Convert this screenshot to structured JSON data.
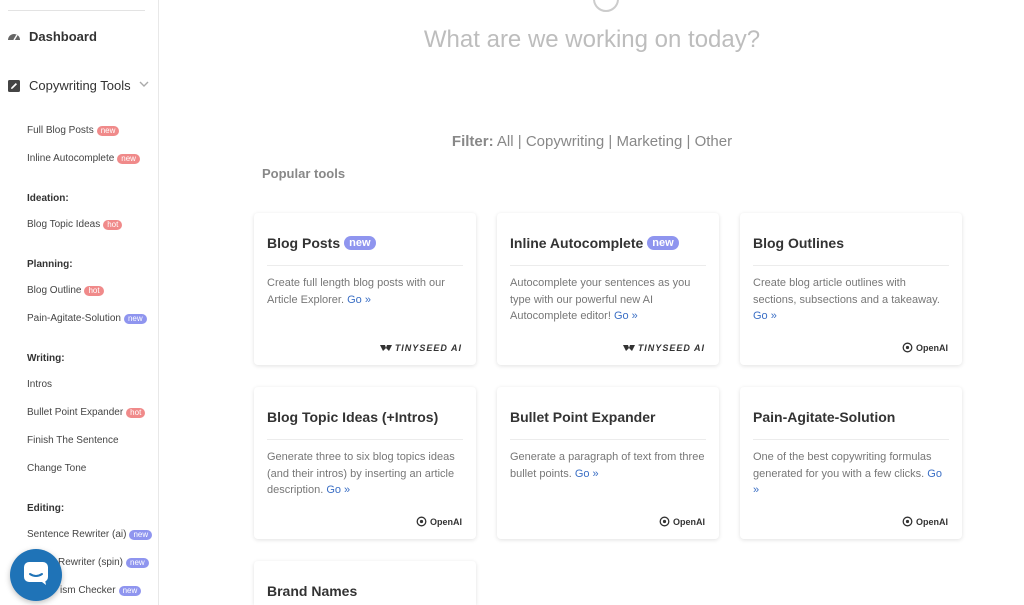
{
  "sidebar": {
    "dashboard": "Dashboard",
    "copywriting_tools": "Copywriting Tools",
    "items": {
      "full_blog_posts": "Full Blog Posts",
      "inline_autocomplete": "Inline Autocomplete",
      "ideation": "Ideation:",
      "blog_topic_ideas": "Blog Topic Ideas",
      "planning": "Planning:",
      "blog_outline": "Blog Outline",
      "pas": "Pain-Agitate-Solution",
      "writing": "Writing:",
      "intros": "Intros",
      "bullet_point_expander": "Bullet Point Expander",
      "finish_the_sentence": "Finish The Sentence",
      "change_tone": "Change Tone",
      "editing": "Editing:",
      "sentence_rewriter_ai": "Sentence Rewriter (ai)",
      "rewriter_spin": "Rewriter (spin)",
      "plagiarism_checker": "ism Checker"
    },
    "badges": {
      "new": "new",
      "hot": "hot"
    }
  },
  "main": {
    "title": "What are we working on today?",
    "filter": {
      "label": "Filter:",
      "all": "All",
      "copywriting": "Copywriting",
      "marketing": "Marketing",
      "other": "Other",
      "sep": "|"
    },
    "popular": "Popular tools"
  },
  "cards": {
    "c1": {
      "title": "Blog Posts",
      "badge": "new",
      "desc": "Create full length blog posts with our Article Explorer.",
      "go": "Go »",
      "provider": "TINYSEED AI"
    },
    "c2": {
      "title": "Inline Autocomplete",
      "badge": "new",
      "desc": "Autocomplete your sentences as you type with our powerful new AI Autocomplete editor!",
      "go": "Go »",
      "provider": "TINYSEED AI"
    },
    "c3": {
      "title": "Blog Outlines",
      "desc": "Create blog article outlines with sections, subsections and a takeaway.",
      "go": "Go »",
      "provider": "OpenAI"
    },
    "c4": {
      "title": "Blog Topic Ideas (+Intros)",
      "desc": "Generate three to six blog topics ideas (and their intros) by inserting an article description.",
      "go": "Go »",
      "provider": "OpenAI"
    },
    "c5": {
      "title": "Bullet Point Expander",
      "desc": "Generate a paragraph of text from three bullet points.",
      "go": "Go »",
      "provider": "OpenAI"
    },
    "c6": {
      "title": "Pain-Agitate-Solution",
      "desc": "One of the best copywriting formulas generated for you with a few clicks.",
      "go": "Go »",
      "provider": "OpenAI"
    },
    "c7": {
      "title": "Brand Names"
    }
  },
  "colors": {
    "accent": "#3b6fc5",
    "badge_purple": "#8f95ef",
    "badge_pink": "#f08a8a",
    "chat": "#1f73b7"
  }
}
